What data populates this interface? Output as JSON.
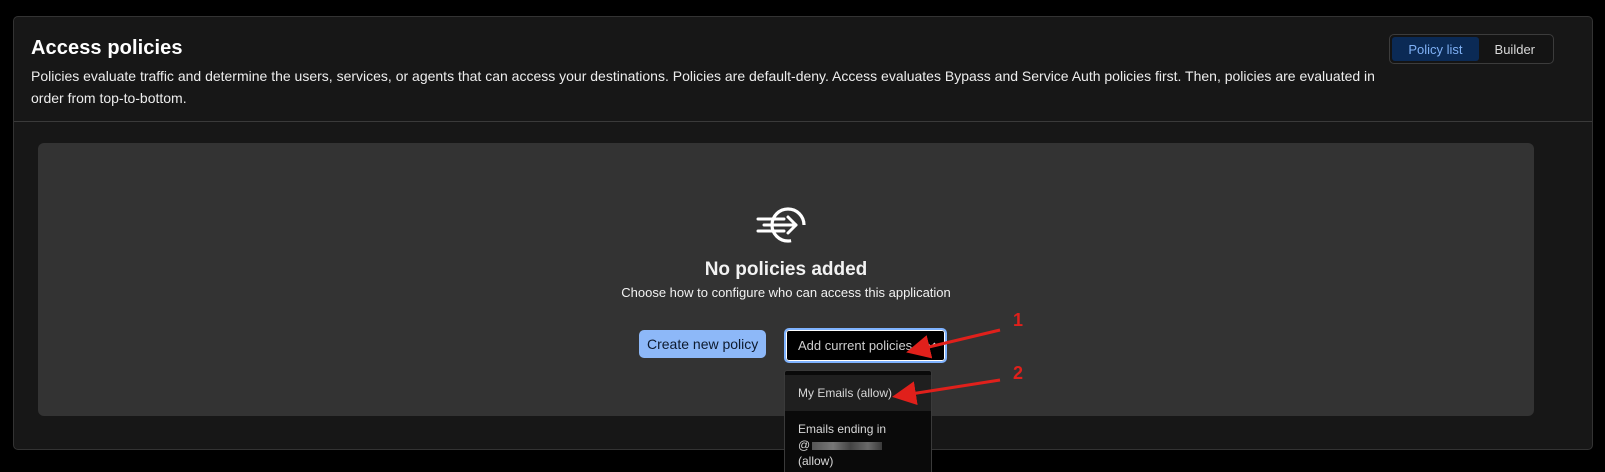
{
  "header": {
    "title": "Access policies",
    "description": "Policies evaluate traffic and determine the users, services, or agents that can access your destinations. Policies are default-deny. Access evaluates Bypass and Service Auth policies first. Then, policies are evaluated in order from top-to-bottom.",
    "view_toggle": {
      "options": [
        "Policy list",
        "Builder"
      ],
      "selected": "Policy list"
    }
  },
  "empty_state": {
    "icon": "arrow-into-circle-icon",
    "title": "No policies added",
    "subtitle": "Choose how to configure who can access this application",
    "create_button": "Create new policy",
    "select": {
      "value": "Add current policies",
      "options": [
        {
          "label": "My Emails (allow)"
        },
        {
          "label_line1": "Emails ending in",
          "label_line2": "@",
          "label_line3": "(allow)"
        }
      ]
    }
  },
  "annotations": {
    "marker_1": "1",
    "marker_2": "2",
    "color": "#e0201b"
  },
  "colors": {
    "accent": "#8db8f8",
    "focus_ring": "#7fb3ff",
    "active_segment_bg": "#0b2a55"
  }
}
